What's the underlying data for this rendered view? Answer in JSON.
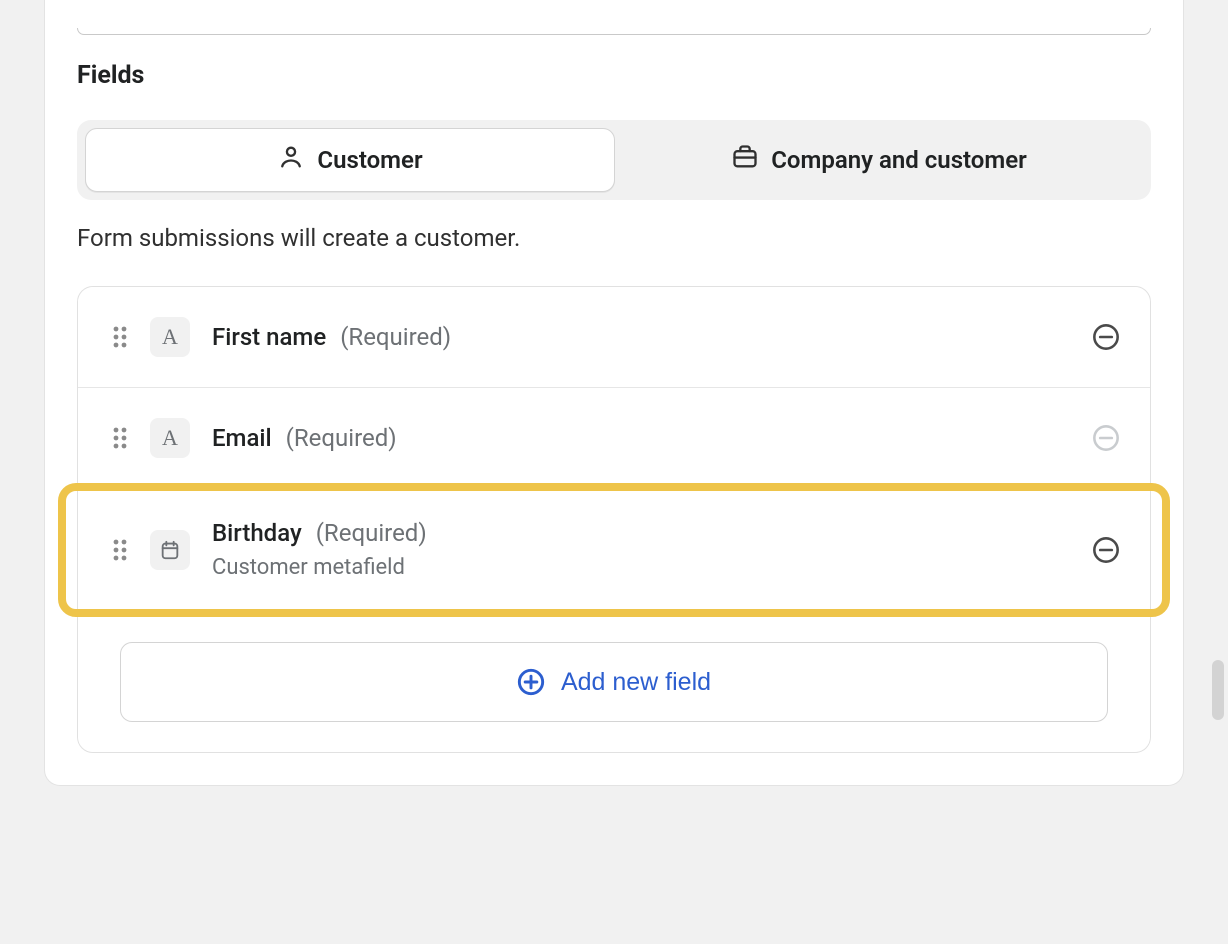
{
  "section_title": "Fields",
  "segmented": {
    "customer": "Customer",
    "company": "Company and customer"
  },
  "help_text": "Form submissions will create a customer.",
  "required_label": "(Required)",
  "fields": [
    {
      "label": "First name",
      "icon_letter": "A",
      "removable": true
    },
    {
      "label": "Email",
      "icon_letter": "A",
      "removable": false
    },
    {
      "label": "Birthday",
      "subtext": "Customer metafield",
      "icon_type": "calendar",
      "removable": true,
      "highlighted": true
    }
  ],
  "add_button": "Add new field"
}
